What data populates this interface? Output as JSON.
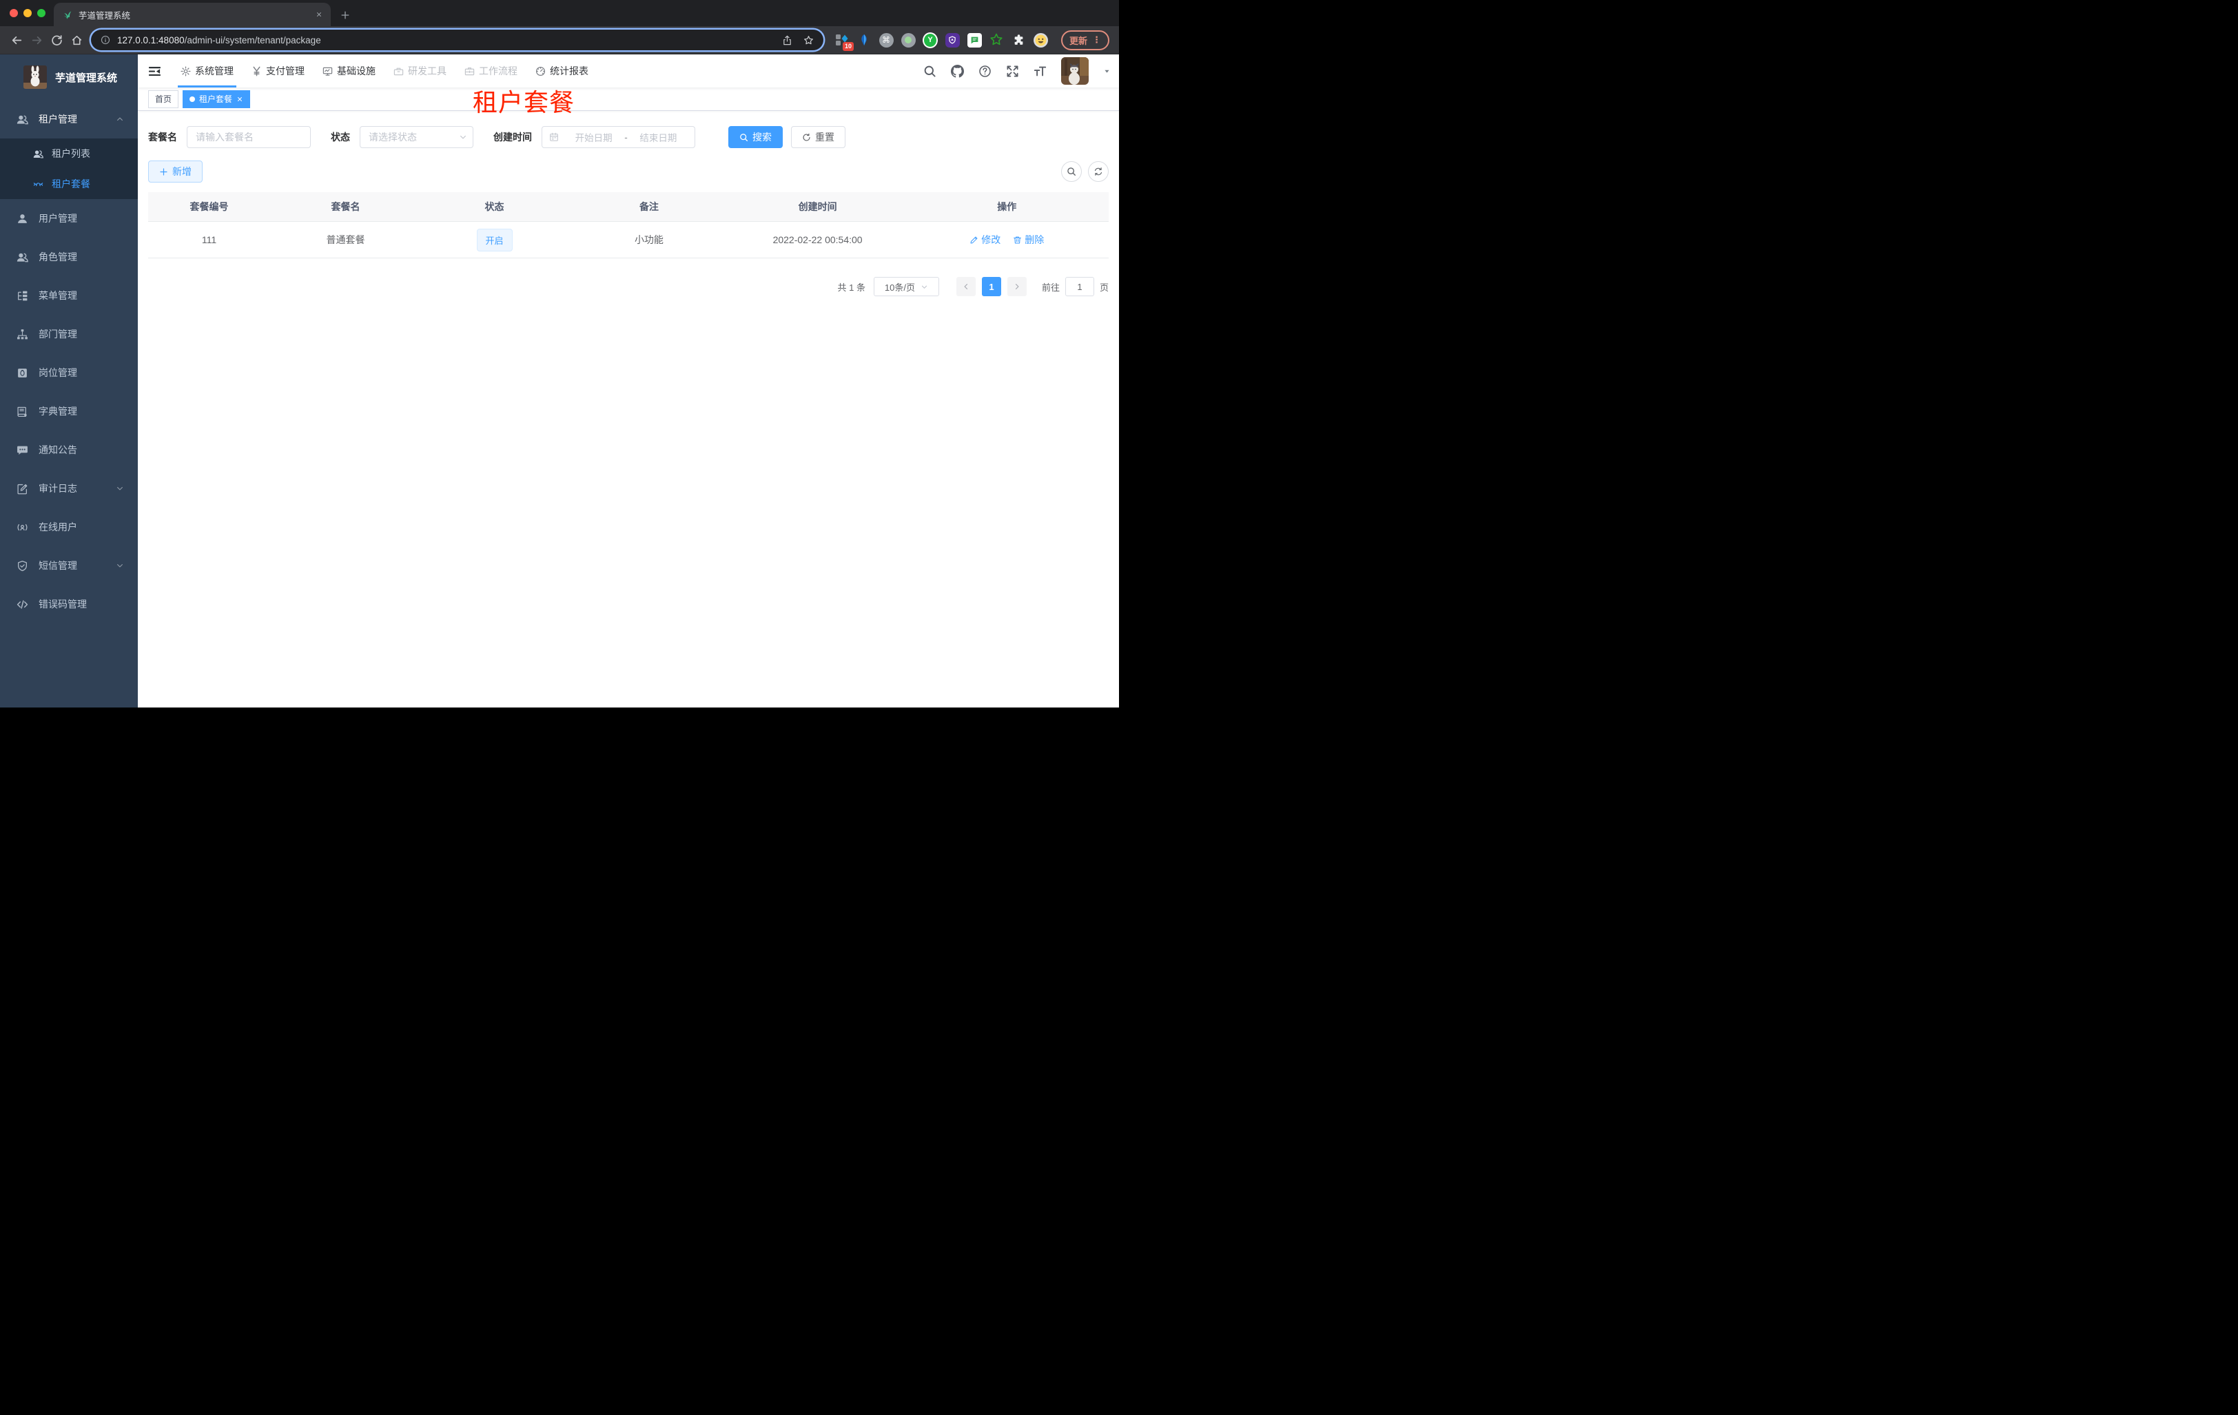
{
  "browser": {
    "tab_title": "芋道管理系统",
    "url_host": "127.0.0.1:48080",
    "url_path": "/admin-ui/system/tenant/package",
    "update_label": "更新",
    "update_dots": "⋮",
    "extension_badge": "10",
    "extension_y_letter": "Y",
    "extension_cmd_glyph": "⌘",
    "extensions": [
      "proxy",
      "kite",
      "cmd",
      "record",
      "y-circle",
      "shield",
      "chat",
      "star",
      "puzzle",
      "profile"
    ]
  },
  "sidebar": {
    "title": "芋道管理系统",
    "menu": [
      {
        "key": "tenant",
        "icon": "people-icon",
        "label": "租户管理",
        "chevron": "up",
        "open": true,
        "children": [
          {
            "key": "tenant-list",
            "icon": "people-icon",
            "label": "租户列表",
            "active": false
          },
          {
            "key": "tenant-package",
            "icon": "eyes-icon",
            "label": "租户套餐",
            "active": true
          }
        ]
      },
      {
        "key": "user",
        "icon": "person-icon",
        "label": "用户管理"
      },
      {
        "key": "role",
        "icon": "people-icon",
        "label": "角色管理"
      },
      {
        "key": "menu",
        "icon": "tree-icon",
        "label": "菜单管理"
      },
      {
        "key": "dept",
        "icon": "org-icon",
        "label": "部门管理"
      },
      {
        "key": "post",
        "icon": "badge-icon",
        "label": "岗位管理"
      },
      {
        "key": "dict",
        "icon": "book-icon",
        "label": "字典管理"
      },
      {
        "key": "notice",
        "icon": "chat-icon",
        "label": "通知公告"
      },
      {
        "key": "audit-log",
        "icon": "editlog-icon",
        "label": "审计日志",
        "chevron": "down"
      },
      {
        "key": "online-user",
        "icon": "online-icon",
        "label": "在线用户"
      },
      {
        "key": "sms",
        "icon": "shieldcheck-icon",
        "label": "短信管理",
        "chevron": "down"
      },
      {
        "key": "error-code",
        "icon": "code-icon",
        "label": "错误码管理"
      }
    ]
  },
  "header": {
    "nav": [
      {
        "key": "system",
        "icon": "gear-icon",
        "label": "系统管理",
        "active": true
      },
      {
        "key": "pay",
        "icon": "yen-icon",
        "label": "支付管理"
      },
      {
        "key": "infra",
        "icon": "monitor-icon",
        "label": "基础设施"
      },
      {
        "key": "dev-tools",
        "icon": "toolbox-icon",
        "label": "研发工具",
        "muted": true
      },
      {
        "key": "workflow",
        "icon": "briefcase-icon",
        "label": "工作流程",
        "muted": true
      },
      {
        "key": "report",
        "icon": "dashboard-icon",
        "label": "统计报表"
      }
    ],
    "tools": [
      {
        "key": "search",
        "icon": "search-icon"
      },
      {
        "key": "github",
        "icon": "github-icon"
      },
      {
        "key": "help",
        "icon": "question-icon"
      },
      {
        "key": "fullscreen",
        "icon": "fullscreen-icon"
      },
      {
        "key": "font-size",
        "icon": "fontsize-icon"
      }
    ]
  },
  "tags": [
    {
      "key": "home",
      "label": "首页",
      "active": false,
      "closable": false
    },
    {
      "key": "tenant-package",
      "label": "租户套餐",
      "active": true,
      "closable": true
    }
  ],
  "annotation": "租户套餐",
  "filters": {
    "name_label": "套餐名",
    "name_placeholder": "请输入套餐名",
    "status_label": "状态",
    "status_placeholder": "请选择状态",
    "date_label": "创建时间",
    "date_start_placeholder": "开始日期",
    "date_separator": "-",
    "date_end_placeholder": "结束日期",
    "search_label": "搜索",
    "reset_label": "重置"
  },
  "toolbar": {
    "add_label": "新增"
  },
  "table": {
    "columns": [
      "套餐编号",
      "套餐名",
      "状态",
      "备注",
      "创建时间",
      "操作"
    ],
    "rows": [
      {
        "id": "111",
        "name": "普通套餐",
        "status": "开启",
        "remark": "小功能",
        "created": "2022-02-22 00:54:00",
        "actions": [
          {
            "key": "edit",
            "icon": "edit-icon",
            "label": "修改"
          },
          {
            "key": "delete",
            "icon": "trash-icon",
            "label": "删除"
          }
        ]
      }
    ]
  },
  "pagination": {
    "total": "共 1 条",
    "page_size": "10条/页",
    "current": "1",
    "goto_label": "前往",
    "goto_value": "1",
    "unit": "页"
  },
  "colors": {
    "accent": "#409eff",
    "annotation_red": "#fe2400",
    "sidebar_bg": "#304156",
    "submenu_bg": "#1f2d3d",
    "status_tag_bg": "#ecf5ff",
    "status_tag_border": "#d9ecff",
    "update_pill": "#e08d7d",
    "url_focus_ring": "#8ab4f8"
  }
}
